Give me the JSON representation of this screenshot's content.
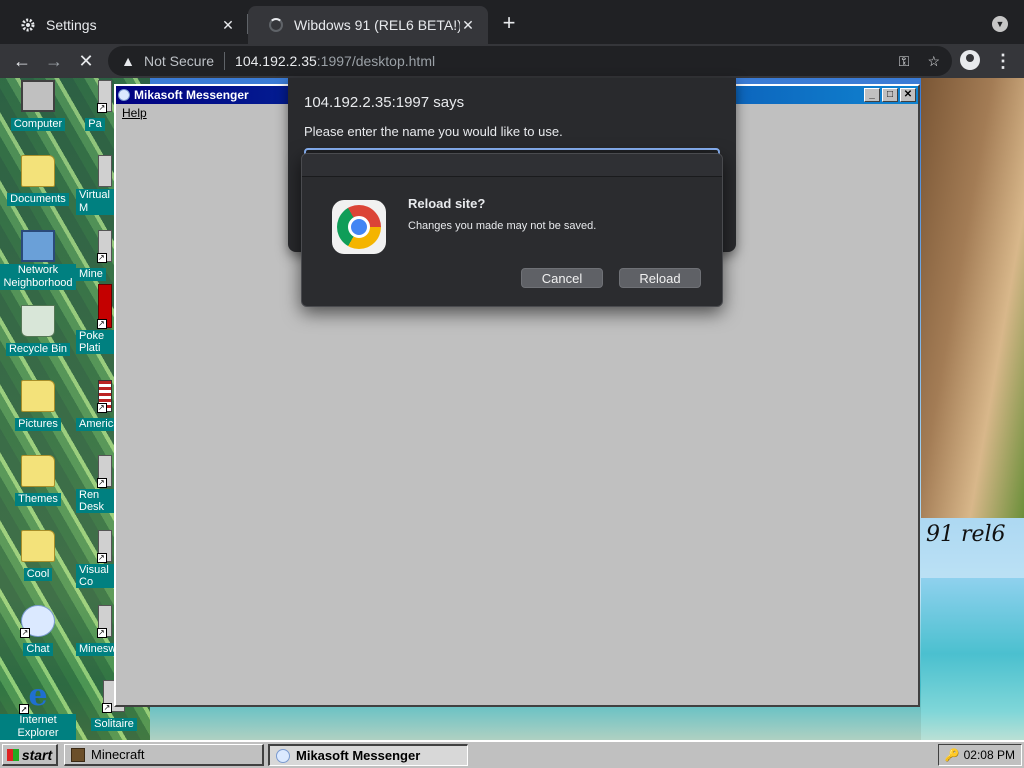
{
  "browser": {
    "tabs": [
      {
        "title": "Settings",
        "icon": "gear-icon",
        "active": false
      },
      {
        "title": "Wibdows 91 (REL6 BETA!)",
        "icon": "loading-spinner-icon",
        "active": true
      }
    ],
    "security_label": "Not Secure",
    "url_host": "104.192.2.35",
    "url_path": ":1997/desktop.html"
  },
  "desktop": {
    "icons": [
      {
        "label": "Computer",
        "type": "computer"
      },
      {
        "label": "Documents",
        "type": "folder"
      },
      {
        "label": "Network Neighborhood",
        "type": "network"
      },
      {
        "label": "Recycle Bin",
        "type": "recycle"
      },
      {
        "label": "Pictures",
        "type": "folder"
      },
      {
        "label": "Themes",
        "type": "folder"
      },
      {
        "label": "Cool",
        "type": "folder"
      },
      {
        "label": "Chat",
        "type": "chat"
      },
      {
        "label": "Internet Explorer",
        "type": "ie"
      }
    ],
    "partial_icons": [
      "Pa",
      "Virtual M",
      "Mine",
      "Poke Plati",
      "America",
      "Ren Desk",
      "Visual Co",
      "Minesw",
      "Solitaire"
    ],
    "wallpaper_text": "91 rel6"
  },
  "messenger_window": {
    "title": "Mikasoft Messenger",
    "menu": [
      "Help"
    ]
  },
  "prompt_dialog": {
    "title": "104.192.2.35:1997 says",
    "message": "Please enter the name you would like to use.",
    "input_value": ""
  },
  "reload_dialog": {
    "title": "Reload site?",
    "message": "Changes you made may not be saved.",
    "cancel_label": "Cancel",
    "reload_label": "Reload"
  },
  "taskbar": {
    "start_label": "start",
    "tasks": [
      {
        "label": "Minecraft",
        "active": false
      },
      {
        "label": "Mikasoft Messenger",
        "active": true
      }
    ],
    "clock": "02:08 PM"
  }
}
